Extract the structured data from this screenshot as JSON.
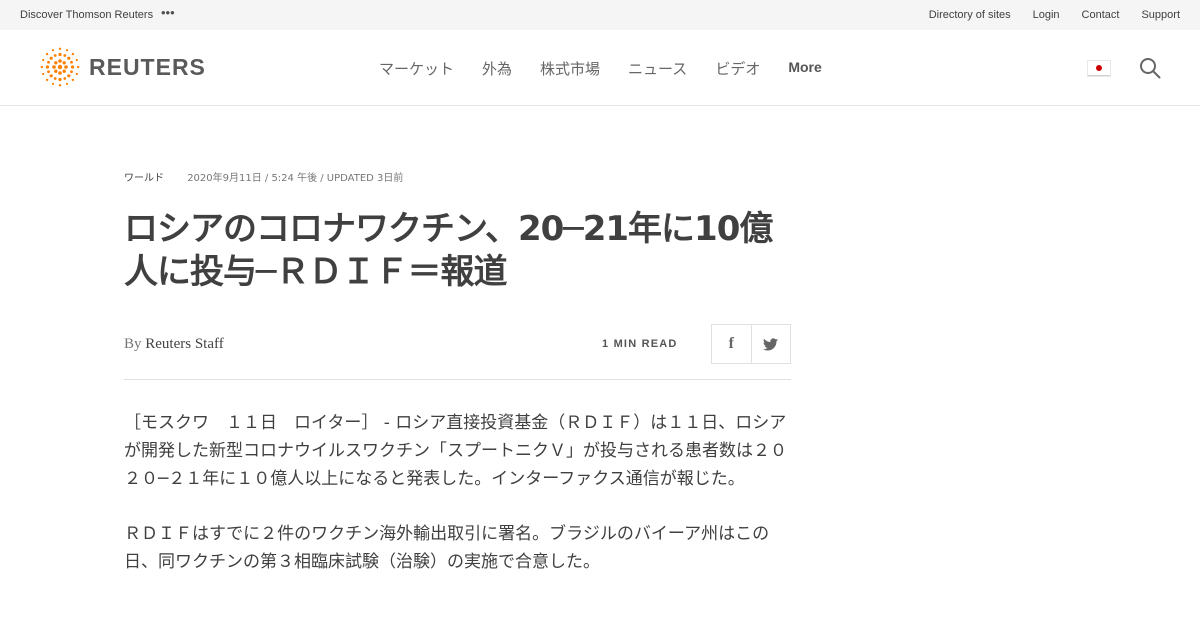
{
  "topbar": {
    "discover_label": "Discover Thomson Reuters",
    "more_dots": "•••",
    "links": [
      "Directory of sites",
      "Login",
      "Contact",
      "Support"
    ]
  },
  "header": {
    "logo_text": "REUTERS",
    "nav": [
      "マーケット",
      "外為",
      "株式市場",
      "ニュース",
      "ビデオ"
    ],
    "nav_more": "More",
    "icons": {
      "flag": "japan-flag-icon",
      "search": "search-icon"
    },
    "colors": {
      "logo_orange": "#ff8000",
      "flag_red": "#cc0000"
    }
  },
  "article": {
    "section": "ワールド",
    "dateline": "2020年9月11日 / 5:24 午後 / UPDATED 3日前",
    "headline": "ロシアのコロナワクチン、20─21年に10億人に投与─ＲＤＩＦ＝報道",
    "byline_prefix": "By",
    "author": "Reuters Staff",
    "read_time": "1 MIN READ",
    "share": {
      "facebook": "f",
      "twitter": "twitter-icon"
    },
    "paragraphs": [
      "［モスクワ　１１日　ロイター］ - ロシア直接投資基金（ＲＤＩＦ）は１１日、ロシアが開発した新型コロナウイルスワクチン「スプートニクＶ」が投与される患者数は２０２０─２１年に１０億人以上になると発表した。インターファクス通信が報じた。",
      "ＲＤＩＦはすでに２件のワクチン海外輸出取引に署名。ブラジルのバイーア州はこの日、同ワクチンの第３相臨床試験（治験）の実施で合意した。"
    ]
  }
}
